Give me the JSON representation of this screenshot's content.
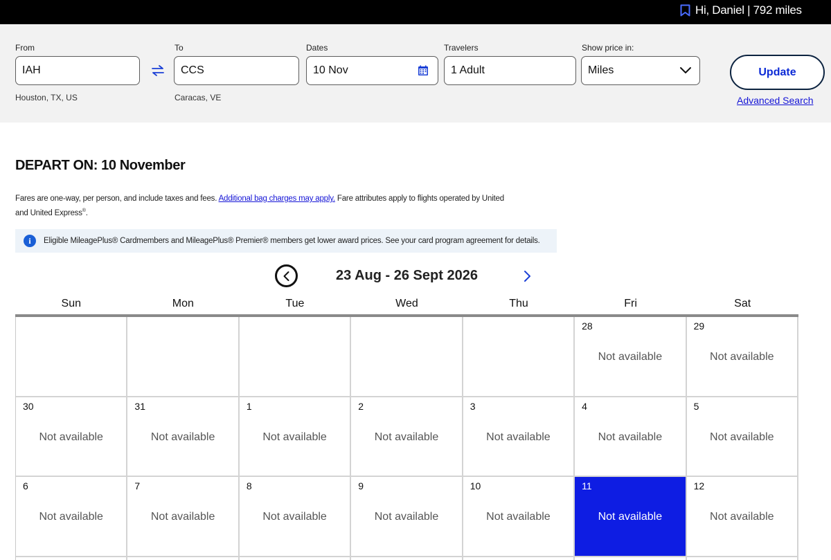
{
  "header": {
    "greeting": "Hi, Daniel | 792 miles",
    "bookmark_icon": "bookmark-icon"
  },
  "search": {
    "from": {
      "label": "From",
      "value": "IAH",
      "sub": "Houston, TX, US"
    },
    "swap_icon": "swap-arrows-icon",
    "to": {
      "label": "To",
      "value": "CCS",
      "sub": "Caracas, VE"
    },
    "dates": {
      "label": "Dates",
      "value": "10 Nov",
      "icon": "calendar-icon"
    },
    "travelers": {
      "label": "Travelers",
      "value": "1 Adult"
    },
    "price": {
      "label": "Show price in:",
      "value": "Miles",
      "icon": "chevron-down-icon"
    },
    "update_label": "Update",
    "advanced_label": "Advanced Search"
  },
  "depart_heading": "DEPART ON: 10 November",
  "notes": {
    "fares_before": "Fares are one-way, per person, and include taxes and fees. ",
    "fares_link": "Additional bag charges may apply.",
    "fares_after": " Fare attributes apply to flights operated by United and United Express",
    "fares_sup": "®",
    "fares_end": ".",
    "info_text": "Eligible MileagePlus® Cardmembers and MileagePlus® Premier® members get lower award prices. See your card program agreement for details.",
    "info_icon": "info-icon"
  },
  "calendar": {
    "range_title": "23 Aug - 26 Sept 2026",
    "prev_icon": "chevron-left-circle-icon",
    "next_icon": "chevron-right-icon",
    "weekdays": [
      "Sun",
      "Mon",
      "Tue",
      "Wed",
      "Thu",
      "Fri",
      "Sat"
    ],
    "weeks": [
      [
        {
          "day": "",
          "status": ""
        },
        {
          "day": "",
          "status": ""
        },
        {
          "day": "",
          "status": ""
        },
        {
          "day": "",
          "status": ""
        },
        {
          "day": "",
          "status": ""
        },
        {
          "day": "28",
          "status": "Not available"
        },
        {
          "day": "29",
          "status": "Not available"
        }
      ],
      [
        {
          "day": "30",
          "status": "Not available"
        },
        {
          "day": "31",
          "status": "Not available"
        },
        {
          "day": "1",
          "status": "Not available"
        },
        {
          "day": "2",
          "status": "Not available"
        },
        {
          "day": "3",
          "status": "Not available"
        },
        {
          "day": "4",
          "status": "Not available"
        },
        {
          "day": "5",
          "status": "Not available"
        }
      ],
      [
        {
          "day": "6",
          "status": "Not available"
        },
        {
          "day": "7",
          "status": "Not available"
        },
        {
          "day": "8",
          "status": "Not available"
        },
        {
          "day": "9",
          "status": "Not available"
        },
        {
          "day": "10",
          "status": "Not available"
        },
        {
          "day": "11",
          "status": "Not available",
          "selected": true
        },
        {
          "day": "12",
          "status": "Not available"
        }
      ]
    ]
  },
  "colors": {
    "selected_day": "#0e1de3",
    "link": "#1414d6",
    "info_background": "#edf3f9",
    "top_bar": "#000000"
  }
}
